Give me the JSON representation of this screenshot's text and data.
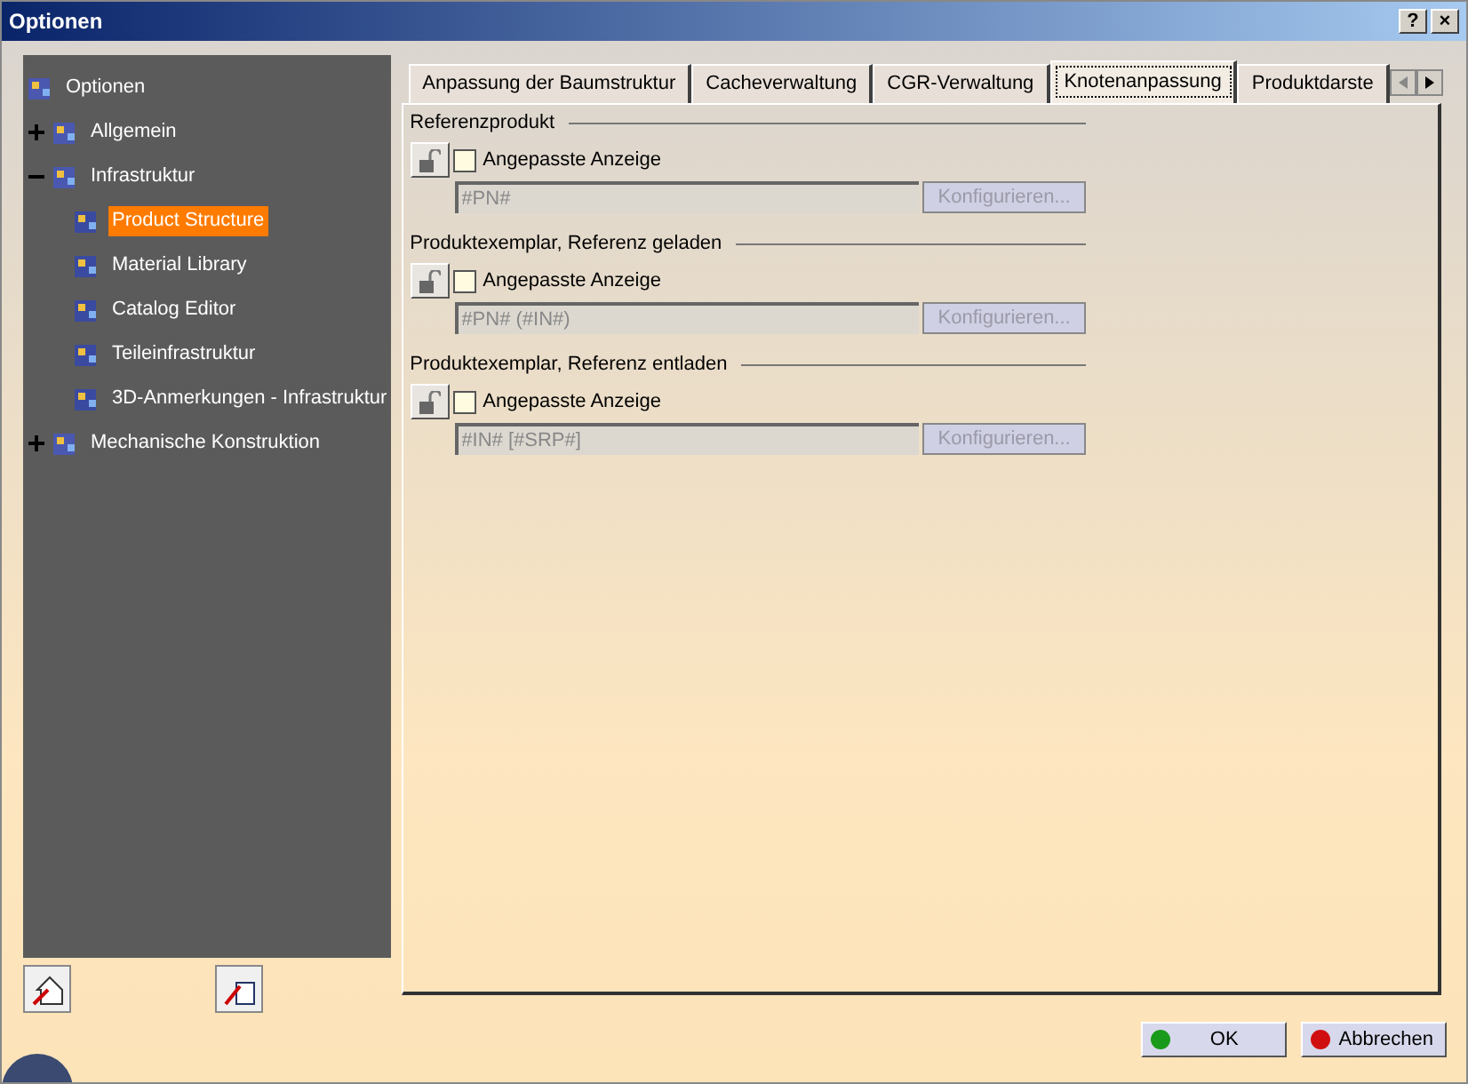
{
  "window": {
    "title": "Optionen",
    "buttons": [
      "?",
      "×"
    ]
  },
  "tree": [
    {
      "label": "Optionen",
      "selected": false,
      "children": [
        {
          "label": "Allgemein",
          "selected": false,
          "expanded": false
        },
        {
          "label": "Infrastruktur",
          "selected": false,
          "expanded": true,
          "children": [
            {
              "label": "Product Structure",
              "selected": true
            },
            {
              "label": "Material Library",
              "selected": false
            },
            {
              "label": "Catalog Editor",
              "selected": false
            },
            {
              "label": "Teileinfrastruktur",
              "selected": false
            },
            {
              "label": "3D-Anmerkungen - Infrastruktur",
              "selected": false
            }
          ]
        },
        {
          "label": "Mechanische Konstruktion",
          "selected": false,
          "expanded": false
        }
      ]
    }
  ],
  "tabs": [
    {
      "label": "Anpassung der Baumstruktur",
      "selected": false
    },
    {
      "label": "Cacheverwaltung",
      "selected": false
    },
    {
      "label": "CGR-Verwaltung",
      "selected": false
    },
    {
      "label": "Knotenanpassung",
      "selected": true
    },
    {
      "label": "Produktdarste",
      "selected": false
    }
  ],
  "sections": [
    {
      "title": "Referenzprodukt",
      "checkbox": {
        "label": "Angepasste Anzeige",
        "checked": false
      },
      "value": "#PN#",
      "button": "Konfigurieren..."
    },
    {
      "title": "Produktexemplar, Referenz geladen",
      "checkbox": {
        "label": "Angepasste Anzeige",
        "checked": false
      },
      "value": "#PN# (#IN#)",
      "button": "Konfigurieren..."
    },
    {
      "title": "Produktexemplar, Referenz entladen",
      "checkbox": {
        "label": "Angepasste Anzeige",
        "checked": false
      },
      "value": "#IN# [#SRP#]",
      "button": "Konfigurieren..."
    }
  ],
  "footer": {
    "ok": "OK",
    "cancel": "Abbrechen"
  }
}
